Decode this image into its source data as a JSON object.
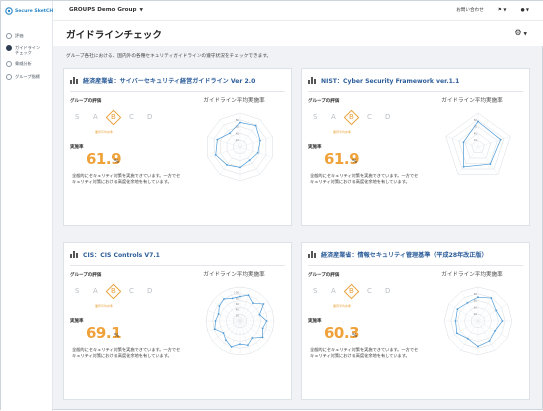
{
  "app": {
    "name": "Secure SketCH"
  },
  "sidebar": {
    "items": [
      {
        "label": "評価"
      },
      {
        "label": "ガイドライン\nチェック"
      },
      {
        "label": "脅威分析"
      },
      {
        "label": "グループ指標"
      }
    ]
  },
  "header": {
    "group_select": "GROUPS Demo Group",
    "contact": "お問い合わせ"
  },
  "page": {
    "title": "ガイドラインチェック",
    "description": "グループ各社における、国内外の各種セキュリティガイドラインの遵守状況をチェックできます。"
  },
  "colors": {
    "accent": "#f0a23a",
    "title_blue": "#2c5d9a",
    "radar_line": "#4f9bd6",
    "nav_dark": "#2e3d52"
  },
  "cards": [
    {
      "title": "経済産業省：サイバーセキュリティ経営ガイドライン Ver 2.0",
      "eval_label": "グループの評価",
      "grades": [
        "S",
        "A",
        "B",
        "C",
        "D"
      ],
      "selected_grade": "B",
      "sub_label": "業界平均水準",
      "rate_label": "実施率",
      "rate": "61.9",
      "unit": "%",
      "desc": "全般的にセキュリティ対策を実施できています。一方でセキュリティ対策における高度化余地を有しています。",
      "radar_title": "ガイドライン平均実施率",
      "radar_ticks": [
        "80",
        "60",
        "40",
        "20"
      ],
      "radar_values": [
        0.72,
        0.78,
        0.62,
        0.55,
        0.48,
        0.6,
        0.65,
        0.75,
        0.7,
        0.5
      ]
    },
    {
      "title": "NIST：Cyber Security Framework ver.1.1",
      "eval_label": "グループの評価",
      "grades": [
        "S",
        "A",
        "B",
        "C",
        "D"
      ],
      "selected_grade": "B",
      "sub_label": "業界平均水準",
      "rate_label": "実施率",
      "rate": "61.9",
      "unit": "%",
      "desc": "全般的にセキュリティ対策を実施できています。一方でセキュリティ対策における高度化余地を有しています。",
      "radar_title": "ガイドライン平均実施率",
      "radar_ticks": [
        "80",
        "60",
        "40",
        "20"
      ],
      "radar_values": [
        0.75,
        0.7,
        0.62,
        0.72,
        0.45
      ]
    },
    {
      "title": "CIS：CIS Controls V7.1",
      "eval_label": "グループの評価",
      "grades": [
        "S",
        "A",
        "B",
        "C",
        "D"
      ],
      "selected_grade": "B",
      "sub_label": "業界平均水準",
      "rate_label": "実施率",
      "rate": "69.1",
      "unit": "%",
      "desc": "全般的にセキュリティ対策を実施できています。一方でセキュリティ対策における高度化余地を有しています。",
      "radar_title": "ガイドライン平均実施率",
      "radar_ticks": [
        "100",
        "80",
        "60",
        "40",
        "20"
      ],
      "radar_values": [
        0.72,
        0.8,
        0.65,
        0.85,
        0.6,
        0.78,
        0.7,
        0.82,
        0.62,
        0.75,
        0.68,
        0.8,
        0.7,
        0.6,
        0.78,
        0.72,
        0.66,
        0.75,
        0.8,
        0.7
      ]
    },
    {
      "title": "経済産業省：情報セキュリティ管理基準（平成28年改正版）",
      "eval_label": "グループの評価",
      "grades": [
        "S",
        "A",
        "B",
        "C",
        "D"
      ],
      "selected_grade": "B",
      "sub_label": "業界平均水準",
      "rate_label": "実施率",
      "rate": "60.3",
      "unit": "%",
      "desc": "全般的にセキュリティ対策を実施できています。一方でセキュリティ対策における高度化余地を有しています。",
      "radar_title": "ガイドライン平均実施率",
      "radar_ticks": [
        "80",
        "60",
        "40",
        "20"
      ],
      "radar_values": [
        0.7,
        0.78,
        0.62,
        0.72,
        0.58,
        0.68,
        0.75,
        0.6,
        0.72,
        0.66,
        0.7,
        0.62
      ]
    }
  ]
}
